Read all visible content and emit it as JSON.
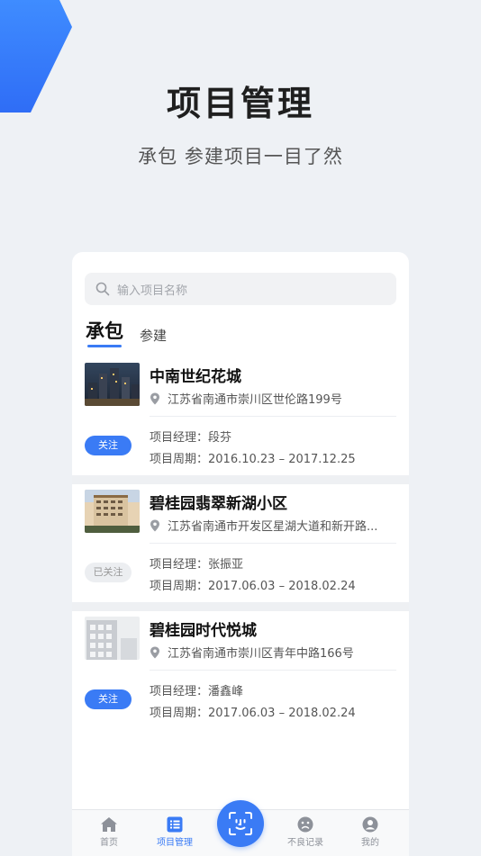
{
  "hero": {
    "title": "项目管理",
    "subtitle": "承包 参建项目一目了然"
  },
  "search": {
    "placeholder": "输入项目名称",
    "icon": "search-icon"
  },
  "tabs": [
    {
      "label": "承包",
      "active": true
    },
    {
      "label": "参建",
      "active": false
    }
  ],
  "projects": [
    {
      "name": "中南世纪花城",
      "address": "江苏省南通市崇川区世伦路199号",
      "manager": "项目经理：段芬",
      "period": "项目周期：2016.10.23 – 2017.12.25",
      "follow_label": "关注",
      "followed": false
    },
    {
      "name": "碧桂园翡翠新湖小区",
      "address": "江苏省南通市开发区星湖大道和新开路...",
      "manager": "项目经理：张振亚",
      "period": "项目周期：2017.06.03 – 2018.02.24",
      "follow_label": "已关注",
      "followed": true
    },
    {
      "name": "碧桂园时代悦城",
      "address": "江苏省南通市崇川区青年中路166号",
      "manager": "项目经理：潘鑫峰",
      "period": "项目周期：2017.06.03 – 2018.02.24",
      "follow_label": "关注",
      "followed": false
    }
  ],
  "nav": {
    "home": "首页",
    "projects": "项目管理",
    "records": "不良记录",
    "mine": "我的"
  },
  "colors": {
    "accent": "#3a7bf5",
    "background": "#eef1f5"
  }
}
